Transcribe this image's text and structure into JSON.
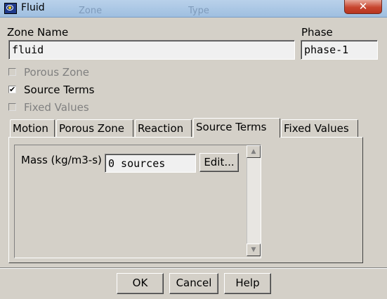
{
  "window": {
    "title": "Fluid",
    "background_text": [
      "Zone",
      "Type"
    ],
    "close_symbol": "✕"
  },
  "zone_name": {
    "label": "Zone Name",
    "value": "fluid"
  },
  "phase": {
    "label": "Phase",
    "value": "phase-1"
  },
  "options": [
    {
      "label": "Porous Zone",
      "checked": false,
      "enabled": false,
      "mark": ""
    },
    {
      "label": "Source Terms",
      "checked": true,
      "enabled": true,
      "mark": "✔"
    },
    {
      "label": "Fixed Values",
      "checked": false,
      "enabled": false,
      "mark": ""
    }
  ],
  "tabs": [
    {
      "label": "Motion"
    },
    {
      "label": "Porous Zone"
    },
    {
      "label": "Reaction"
    },
    {
      "label": "Source Terms",
      "active": true
    },
    {
      "label": "Fixed Values"
    }
  ],
  "source_terms": {
    "mass_label": "Mass (kg/m3-s)",
    "mass_value": "0 sources",
    "edit_label": "Edit..."
  },
  "scrollbar": {
    "up": "▲",
    "down": "▼"
  },
  "buttons": {
    "ok": "OK",
    "cancel": "Cancel",
    "help": "Help"
  }
}
